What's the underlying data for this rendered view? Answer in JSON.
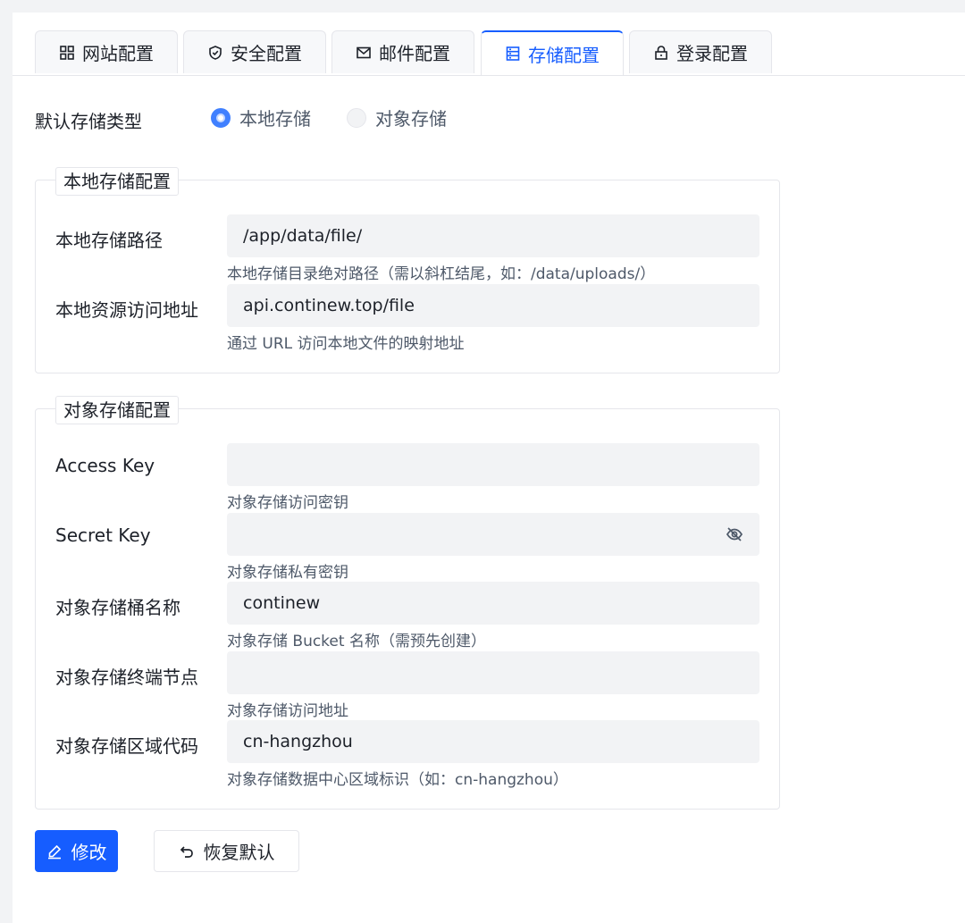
{
  "tabs": [
    {
      "label": "网站配置",
      "icon": "grid-icon",
      "active": false
    },
    {
      "label": "安全配置",
      "icon": "shield-icon",
      "active": false
    },
    {
      "label": "邮件配置",
      "icon": "mail-icon",
      "active": false
    },
    {
      "label": "存储配置",
      "icon": "storage-icon",
      "active": true
    },
    {
      "label": "登录配置",
      "icon": "lock-icon",
      "active": false
    }
  ],
  "storage_type": {
    "label": "默认存储类型",
    "options": [
      {
        "label": "本地存储",
        "selected": true
      },
      {
        "label": "对象存储",
        "selected": false
      }
    ]
  },
  "local": {
    "legend": "本地存储配置",
    "path_label": "本地存储路径",
    "path_value": "/app/data/file/",
    "path_hint": "本地存储目录绝对路径（需以斜杠结尾，如：/data/uploads/）",
    "url_label": "本地资源访问地址",
    "url_value": "api.continew.top/file",
    "url_hint": "通过 URL 访问本地文件的映射地址"
  },
  "object": {
    "legend": "对象存储配置",
    "access_key_label": "Access Key",
    "access_key_value": "",
    "access_key_hint": "对象存储访问密钥",
    "secret_key_label": "Secret Key",
    "secret_key_value": "",
    "secret_key_hint": "对象存储私有密钥",
    "bucket_label": "对象存储桶名称",
    "bucket_value": "continew",
    "bucket_hint": "对象存储 Bucket 名称（需预先创建）",
    "endpoint_label": "对象存储终端节点",
    "endpoint_value": "",
    "endpoint_hint": "对象存储访问地址",
    "region_label": "对象存储区域代码",
    "region_value": "cn-hangzhou",
    "region_hint": "对象存储数据中心区域标识（如：cn-hangzhou）"
  },
  "actions": {
    "edit_label": "修改",
    "reset_label": "恢复默认"
  },
  "colors": {
    "primary": "#165dff",
    "input_bg": "#f2f3f5",
    "border": "#e5e6eb"
  }
}
